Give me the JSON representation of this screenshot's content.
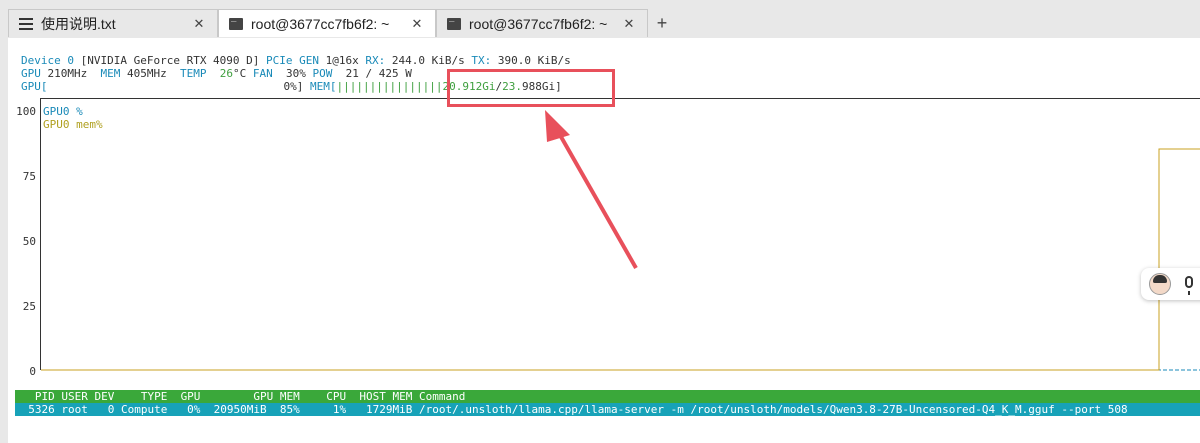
{
  "tabs": [
    {
      "label": "使用说明.txt",
      "active": false
    },
    {
      "label": "root@3677cc7fb6f2: ~",
      "active": true
    },
    {
      "label": "root@3677cc7fb6f2: ~",
      "active": false
    }
  ],
  "add_tab": "+",
  "close_glyph": "✕",
  "nvtop": {
    "device_label": "Device 0",
    "device_name": "[NVIDIA GeForce RTX 4090 D]",
    "pcie_label": "PCIe GEN",
    "pcie_value": "1@16x",
    "rx_label": "RX:",
    "rx_value": "244.0 KiB/s",
    "tx_label": "TX:",
    "tx_value": "390.0 KiB/s",
    "gpu_clock_label": "GPU",
    "gpu_clock_value": "210MHz",
    "mem_clock_label": "MEM",
    "mem_clock_value": "405MHz",
    "temp_label": "TEMP",
    "temp_value": "26",
    "temp_unit": "°C",
    "fan_label": "FAN",
    "fan_value": "30%",
    "pow_label": "POW",
    "pow_value": "21 / 425 W",
    "gpu_util_label": "GPU[",
    "gpu_util_value": "0%]",
    "mem_bar_label": "MEM[",
    "mem_bar_fill": "||||||||||||||||",
    "mem_used": "20.912Gi",
    "mem_sep": "/",
    "mem_total": "23.",
    "mem_total_rest": "988Gi]"
  },
  "chart_data": {
    "type": "line",
    "y_ticks": [
      "100",
      "75",
      "50",
      "25",
      "0"
    ],
    "ylim": [
      0,
      100
    ],
    "grid": false,
    "legend_placement": "top-left",
    "series": [
      {
        "name": "GPU0 %",
        "color": "#1a8ab8",
        "values": [
          0,
          0
        ]
      },
      {
        "name": "GPU0 mem%",
        "color": "#c8a020",
        "values": [
          0,
          85
        ]
      }
    ]
  },
  "processes": {
    "header": "   PID USER DEV    TYPE  GPU        GPU MEM    CPU  HOST MEM Command",
    "row": "  5326 root   0 Compute   0%  20950MiB  85%     1%   1729MiB /root/.unsloth/llama.cpp/llama-server -m /root/unsloth/models/Qwen3.8-27B-Uncensored-Q4_K_M.gguf --port 508"
  },
  "colors": {
    "highlight": "#e8505b",
    "process_header_bg": "#3aa83a",
    "process_row_bg": "#17a2b8"
  }
}
